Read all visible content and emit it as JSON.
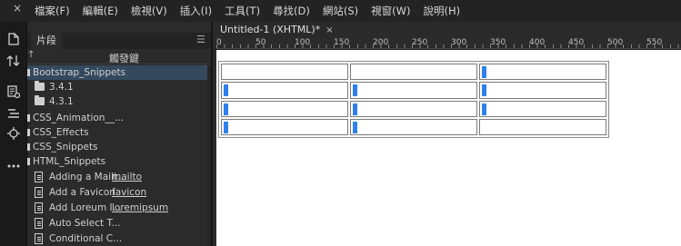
{
  "window": {
    "close_glyph": "×"
  },
  "menu": [
    "檔案(F)",
    "編輯(E)",
    "檢視(V)",
    "插入(I)",
    "工具(T)",
    "尋找(D)",
    "網站(S)",
    "視窗(W)",
    "說明(H)"
  ],
  "toolbar_icons": [
    "file-icon",
    "file-transfer-icon",
    "insert-panel-icon",
    "dom-tree-icon",
    "target-icon",
    "more-icon"
  ],
  "panel": {
    "tab": "片段",
    "column_header": "觸發鍵",
    "items": [
      {
        "type": "folder",
        "label": "Bootstrap_Snippets",
        "selected": true
      },
      {
        "type": "subfolder",
        "label": "3.4.1"
      },
      {
        "type": "subfolder",
        "label": "4.3.1"
      },
      {
        "type": "folder",
        "label": "CSS_Animation__..."
      },
      {
        "type": "folder",
        "label": "CSS_Effects"
      },
      {
        "type": "folder",
        "label": "CSS_Snippets"
      },
      {
        "type": "folder",
        "label": "HTML_Snippets"
      },
      {
        "type": "snippet",
        "label": "Adding a Mailt...",
        "trigger": "mailto"
      },
      {
        "type": "snippet",
        "label": "Add a Favicon",
        "trigger": "favicon"
      },
      {
        "type": "snippet",
        "label": "Add Loreum I...",
        "trigger": "loremipsum"
      },
      {
        "type": "snippet",
        "label": "Auto Select T...",
        "trigger": ""
      },
      {
        "type": "snippet",
        "label": "Conditional C...",
        "trigger": ""
      }
    ]
  },
  "document": {
    "tab_title": "Untitled-1 (XHTML)*",
    "tab_close": "×",
    "ruler_labels": [
      "0",
      "50",
      "100",
      "150",
      "200",
      "250",
      "300",
      "350",
      "400",
      "450",
      "500",
      "550"
    ],
    "table": {
      "rows": 4,
      "cols": 3,
      "cursor_cells": [
        [
          0,
          2
        ],
        [
          1,
          0
        ],
        [
          1,
          1
        ],
        [
          1,
          2
        ],
        [
          2,
          0
        ],
        [
          2,
          1
        ],
        [
          2,
          2
        ],
        [
          3,
          0
        ],
        [
          3,
          1
        ]
      ]
    }
  },
  "colors": {
    "accent": "#2f80ed",
    "selection": "#34495e"
  }
}
